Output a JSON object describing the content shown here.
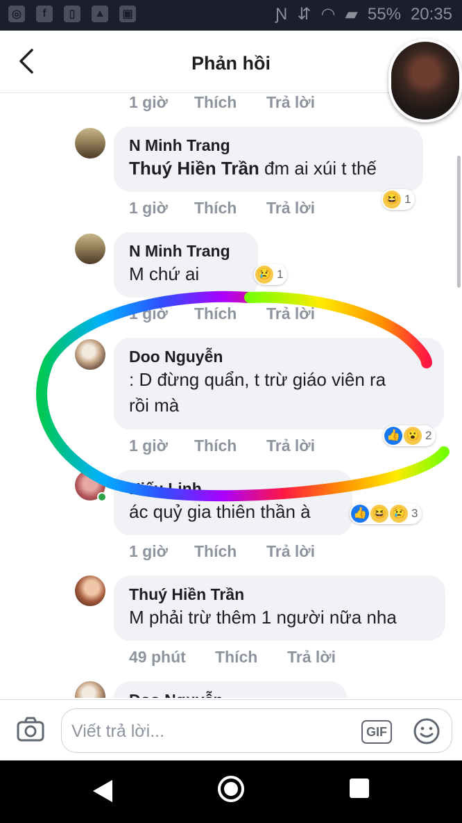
{
  "status_bar": {
    "battery": "55%",
    "time": "20:35",
    "icons": [
      "messenger-icon",
      "facebook-icon",
      "sim-icon",
      "lock-icon",
      "gallery-icon",
      "nfc-icon",
      "vibrate-icon",
      "wifi-icon",
      "signal-icon"
    ]
  },
  "header": {
    "title": "Phản hồi",
    "back_icon": "back-arrow-icon"
  },
  "labels": {
    "like": "Thích",
    "reply": "Trả lời"
  },
  "top_meta": {
    "time": "1 giờ"
  },
  "comments": [
    {
      "author": "N Minh Trang",
      "mention": "Thuý Hiền Trần",
      "text": " đm ai xúi t thế",
      "time": "1 giờ",
      "reactions": [
        "haha"
      ],
      "count": "1"
    },
    {
      "author": "N Minh Trang",
      "text": "M chứ ai",
      "time": "1 giờ",
      "reactions": [
        "sad"
      ],
      "count": "1"
    },
    {
      "author": "Doo Nguyễn",
      "text_lines": [
        ": D đừng quẩn, t trừ giáo viên ra",
        "rồi mà"
      ],
      "time": "1 giờ",
      "reactions": [
        "like",
        "wow"
      ],
      "count": "2"
    },
    {
      "author": "Hiếu Linh",
      "text": "ác quỷ gia thiên thần à",
      "time": "1 giờ",
      "reactions": [
        "like",
        "haha",
        "sad"
      ],
      "count": "3"
    },
    {
      "author": "Thuý Hiền Trần",
      "text": "M phải trừ thêm 1 người nữa nha",
      "time": "49 phút"
    },
    {
      "author": "Doo Nguyễn"
    }
  ],
  "composer": {
    "placeholder": "Viết trả lời...",
    "gif_label": "GIF"
  },
  "colors": {
    "bubble": "#f0f2f5",
    "meta": "#8d949e",
    "like_blue": "#1877f2",
    "header_bg": "#ffffff",
    "status_bar_bg": "#1a1f2b"
  }
}
